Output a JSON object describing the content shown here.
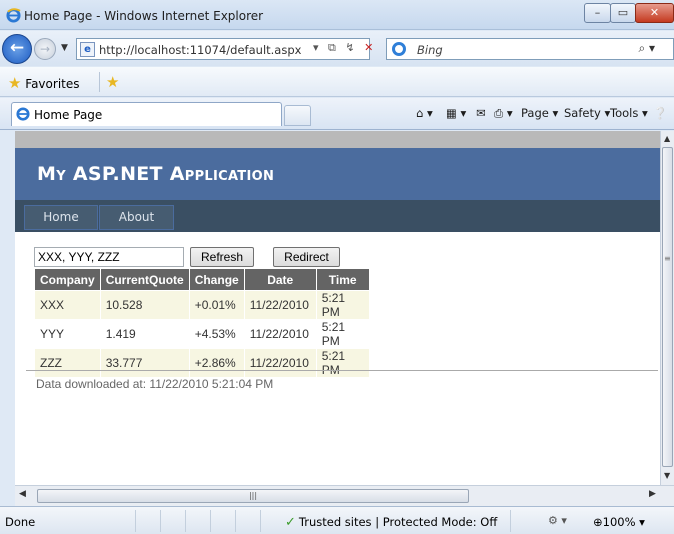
{
  "window": {
    "title": "Home Page - Windows Internet Explorer",
    "min_label": "–",
    "max_label": "▭",
    "close_label": "✕"
  },
  "address_bar": {
    "url": "http://localhost:11074/default.aspx",
    "search_placeholder": "Bing"
  },
  "favorites_bar": {
    "favorites_label": "Favorites"
  },
  "tabs": [
    {
      "label": "Home Page"
    }
  ],
  "command_bar": {
    "page": "Page ▾",
    "safety": "Safety ▾",
    "tools": "Tools ▾"
  },
  "site": {
    "title": "My ASP.NET Application",
    "menu": [
      {
        "label": "Home"
      },
      {
        "label": "About"
      }
    ],
    "symbols_value": "XXX, YYY, ZZZ",
    "refresh_label": "Refresh",
    "redirect_label": "Redirect",
    "table": {
      "headers": [
        "Company",
        "CurrentQuote",
        "Change",
        "Date",
        "Time"
      ],
      "rows": [
        [
          "XXX",
          "10.528",
          "+0.01%",
          "11/22/2010",
          "5:21 PM"
        ],
        [
          "YYY",
          "1.419",
          "+4.53%",
          "11/22/2010",
          "5:21 PM"
        ],
        [
          "ZZZ",
          "33.777",
          "+2.86%",
          "11/22/2010",
          "5:21 PM"
        ]
      ]
    },
    "downloaded_text": "Data downloaded at: 11/22/2010 5:21:04 PM"
  },
  "status_bar": {
    "status": "Done",
    "zone": "Trusted sites | Protected Mode: Off",
    "zoom": "100%"
  },
  "colors": {
    "header_blue": "#4b6c9e",
    "menu_dark": "#3a4f63",
    "table_header": "#646464",
    "row_alt": "#f7f6e2"
  }
}
